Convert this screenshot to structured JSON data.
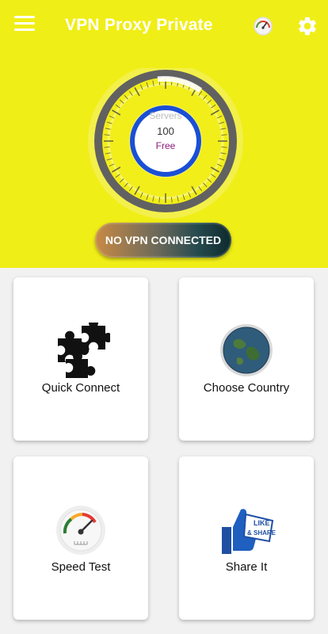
{
  "app": {
    "title": "VPN Proxy Private"
  },
  "toolbar": {
    "menu_icon": "menu-icon",
    "speed_icon": "speedometer-icon",
    "settings_icon": "gear-icon"
  },
  "dial": {
    "servers_label": "Servers",
    "servers_count": "100",
    "plan_label": "Free"
  },
  "status": {
    "text": "NO VPN CONNECTED"
  },
  "cards": {
    "quick_connect": {
      "label": "Quick Connect",
      "icon": "puzzle-icon"
    },
    "choose_country": {
      "label": "Choose Country",
      "icon": "globe-icon"
    },
    "speed_test": {
      "label": "Speed Test",
      "icon": "speedometer-icon"
    },
    "share_it": {
      "label": "Share It",
      "icon": "like-share-icon"
    }
  },
  "colors": {
    "brand_yellow": "#f0ee17",
    "ring_blue": "#1a4fd6",
    "free_purple": "#8a1b7a"
  }
}
